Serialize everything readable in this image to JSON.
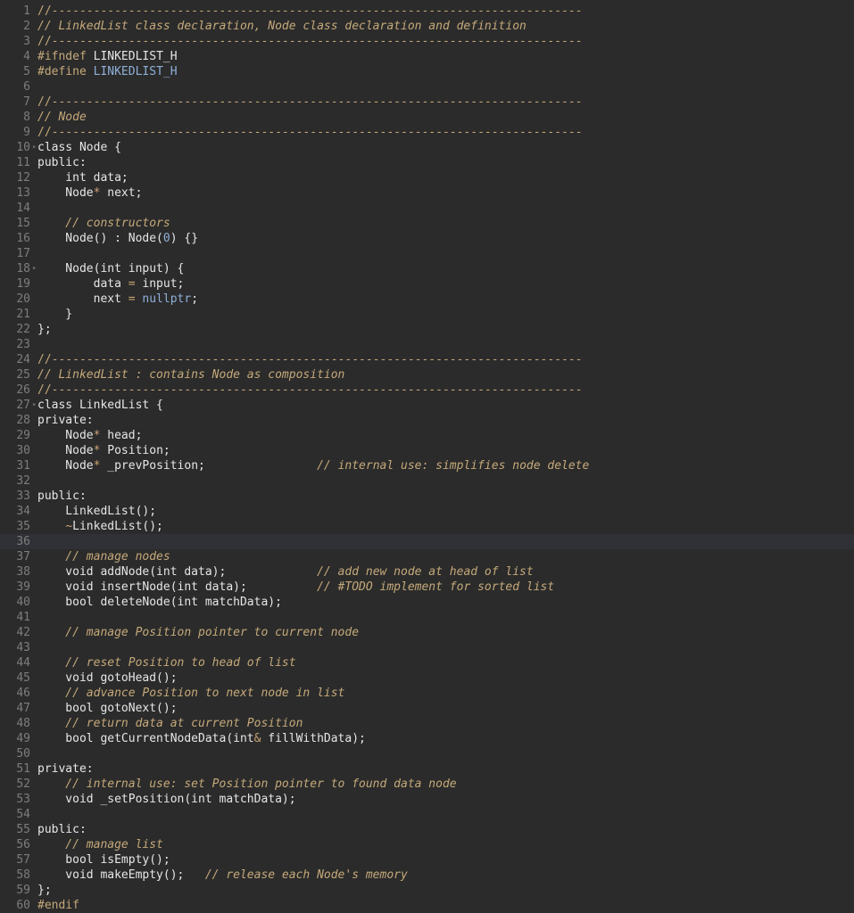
{
  "editor": {
    "language": "C++",
    "colors": {
      "background": "#2b2b2b",
      "comment": "#c5a97a",
      "text": "#e6e6e6",
      "gutter": "#7d7d7d",
      "literal": "#8fb0d8"
    },
    "lines": [
      {
        "n": "1",
        "tokens": [
          {
            "t": "//----------------------------------------------------------------------------",
            "c": "dash"
          }
        ]
      },
      {
        "n": "2",
        "tokens": [
          {
            "t": "// LinkedList class declaration, Node class declaration and definition",
            "c": "cm"
          }
        ]
      },
      {
        "n": "3",
        "tokens": [
          {
            "t": "//----------------------------------------------------------------------------",
            "c": "dash"
          }
        ]
      },
      {
        "n": "4",
        "tokens": [
          {
            "t": "#ifndef",
            "c": "pp"
          },
          {
            "t": " LINKEDLIST_H",
            "c": ""
          }
        ]
      },
      {
        "n": "5",
        "tokens": [
          {
            "t": "#define",
            "c": "pp"
          },
          {
            "t": " LINKEDLIST_H",
            "c": "mac"
          }
        ]
      },
      {
        "n": "6",
        "tokens": []
      },
      {
        "n": "7",
        "tokens": [
          {
            "t": "//----------------------------------------------------------------------------",
            "c": "dash"
          }
        ]
      },
      {
        "n": "8",
        "tokens": [
          {
            "t": "// Node",
            "c": "cm"
          }
        ]
      },
      {
        "n": "9",
        "tokens": [
          {
            "t": "//----------------------------------------------------------------------------",
            "c": "dash"
          }
        ]
      },
      {
        "n": "10",
        "fold": true,
        "tokens": [
          {
            "t": "class Node {",
            "c": ""
          }
        ]
      },
      {
        "n": "11",
        "tokens": [
          {
            "t": "public:",
            "c": ""
          }
        ]
      },
      {
        "n": "12",
        "tokens": [
          {
            "t": "    int data;",
            "c": ""
          }
        ]
      },
      {
        "n": "13",
        "tokens": [
          {
            "t": "    Node",
            "c": ""
          },
          {
            "t": "*",
            "c": "op"
          },
          {
            "t": " next;",
            "c": ""
          }
        ]
      },
      {
        "n": "14",
        "tokens": []
      },
      {
        "n": "15",
        "tokens": [
          {
            "t": "    // constructors",
            "c": "cm"
          }
        ]
      },
      {
        "n": "16",
        "tokens": [
          {
            "t": "    Node() : Node(",
            "c": ""
          },
          {
            "t": "0",
            "c": "num"
          },
          {
            "t": ") {}",
            "c": ""
          }
        ]
      },
      {
        "n": "17",
        "tokens": []
      },
      {
        "n": "18",
        "fold": true,
        "tokens": [
          {
            "t": "    Node(int input) {",
            "c": ""
          }
        ]
      },
      {
        "n": "19",
        "tokens": [
          {
            "t": "        data ",
            "c": ""
          },
          {
            "t": "=",
            "c": "op"
          },
          {
            "t": " input;",
            "c": ""
          }
        ]
      },
      {
        "n": "20",
        "tokens": [
          {
            "t": "        next ",
            "c": ""
          },
          {
            "t": "=",
            "c": "op"
          },
          {
            "t": " ",
            "c": ""
          },
          {
            "t": "nullptr",
            "c": "num"
          },
          {
            "t": ";",
            "c": ""
          }
        ]
      },
      {
        "n": "21",
        "tokens": [
          {
            "t": "    }",
            "c": ""
          }
        ]
      },
      {
        "n": "22",
        "tokens": [
          {
            "t": "};",
            "c": ""
          }
        ]
      },
      {
        "n": "23",
        "tokens": []
      },
      {
        "n": "24",
        "tokens": [
          {
            "t": "//----------------------------------------------------------------------------",
            "c": "dash"
          }
        ]
      },
      {
        "n": "25",
        "tokens": [
          {
            "t": "// LinkedList : contains Node as composition",
            "c": "cm"
          }
        ]
      },
      {
        "n": "26",
        "tokens": [
          {
            "t": "//----------------------------------------------------------------------------",
            "c": "dash"
          }
        ]
      },
      {
        "n": "27",
        "fold": true,
        "tokens": [
          {
            "t": "class LinkedList {",
            "c": ""
          }
        ]
      },
      {
        "n": "28",
        "tokens": [
          {
            "t": "private:",
            "c": ""
          }
        ]
      },
      {
        "n": "29",
        "tokens": [
          {
            "t": "    Node",
            "c": ""
          },
          {
            "t": "*",
            "c": "op"
          },
          {
            "t": " head;",
            "c": ""
          }
        ]
      },
      {
        "n": "30",
        "tokens": [
          {
            "t": "    Node",
            "c": ""
          },
          {
            "t": "*",
            "c": "op"
          },
          {
            "t": " Position;",
            "c": ""
          }
        ]
      },
      {
        "n": "31",
        "tokens": [
          {
            "t": "    Node",
            "c": ""
          },
          {
            "t": "*",
            "c": "op"
          },
          {
            "t": " _prevPosition;                ",
            "c": ""
          },
          {
            "t": "// internal use: simplifies node delete",
            "c": "cm"
          }
        ]
      },
      {
        "n": "32",
        "tokens": []
      },
      {
        "n": "33",
        "tokens": [
          {
            "t": "public:",
            "c": ""
          }
        ]
      },
      {
        "n": "34",
        "tokens": [
          {
            "t": "    LinkedList();",
            "c": ""
          }
        ]
      },
      {
        "n": "35",
        "tokens": [
          {
            "t": "    ",
            "c": ""
          },
          {
            "t": "~",
            "c": "op"
          },
          {
            "t": "LinkedList();",
            "c": ""
          }
        ]
      },
      {
        "n": "36",
        "current": true,
        "tokens": []
      },
      {
        "n": "37",
        "tokens": [
          {
            "t": "    // manage nodes",
            "c": "cm"
          }
        ]
      },
      {
        "n": "38",
        "tokens": [
          {
            "t": "    void addNode(int data);             ",
            "c": ""
          },
          {
            "t": "// add new node at head of list",
            "c": "cm"
          }
        ]
      },
      {
        "n": "39",
        "tokens": [
          {
            "t": "    void insertNode(int data);          ",
            "c": ""
          },
          {
            "t": "// #TODO implement for sorted list",
            "c": "cm"
          }
        ]
      },
      {
        "n": "40",
        "tokens": [
          {
            "t": "    bool deleteNode(int matchData);",
            "c": ""
          }
        ]
      },
      {
        "n": "41",
        "tokens": []
      },
      {
        "n": "42",
        "tokens": [
          {
            "t": "    // manage Position pointer to current node",
            "c": "cm"
          }
        ]
      },
      {
        "n": "43",
        "tokens": []
      },
      {
        "n": "44",
        "tokens": [
          {
            "t": "    // reset Position to head of list",
            "c": "cm"
          }
        ]
      },
      {
        "n": "45",
        "tokens": [
          {
            "t": "    void gotoHead();",
            "c": ""
          }
        ]
      },
      {
        "n": "46",
        "tokens": [
          {
            "t": "    // advance Position to next node in list",
            "c": "cm"
          }
        ]
      },
      {
        "n": "47",
        "tokens": [
          {
            "t": "    bool gotoNext();",
            "c": ""
          }
        ]
      },
      {
        "n": "48",
        "tokens": [
          {
            "t": "    // return data at current Position",
            "c": "cm"
          }
        ]
      },
      {
        "n": "49",
        "tokens": [
          {
            "t": "    bool getCurrentNodeData(int",
            "c": ""
          },
          {
            "t": "&",
            "c": "op"
          },
          {
            "t": " fillWithData);",
            "c": ""
          }
        ]
      },
      {
        "n": "50",
        "tokens": []
      },
      {
        "n": "51",
        "tokens": [
          {
            "t": "private:",
            "c": ""
          }
        ]
      },
      {
        "n": "52",
        "tokens": [
          {
            "t": "    // internal use: set Position pointer to found data node",
            "c": "cm"
          }
        ]
      },
      {
        "n": "53",
        "tokens": [
          {
            "t": "    void _setPosition(int matchData);",
            "c": ""
          }
        ]
      },
      {
        "n": "54",
        "tokens": []
      },
      {
        "n": "55",
        "tokens": [
          {
            "t": "public:",
            "c": ""
          }
        ]
      },
      {
        "n": "56",
        "tokens": [
          {
            "t": "    // manage list",
            "c": "cm"
          }
        ]
      },
      {
        "n": "57",
        "tokens": [
          {
            "t": "    bool isEmpty();",
            "c": ""
          }
        ]
      },
      {
        "n": "58",
        "tokens": [
          {
            "t": "    void makeEmpty();   ",
            "c": ""
          },
          {
            "t": "// release each Node's memory",
            "c": "cm"
          }
        ]
      },
      {
        "n": "59",
        "tokens": [
          {
            "t": "};",
            "c": ""
          }
        ]
      },
      {
        "n": "60",
        "tokens": [
          {
            "t": "#endif",
            "c": "pp"
          }
        ]
      }
    ]
  }
}
